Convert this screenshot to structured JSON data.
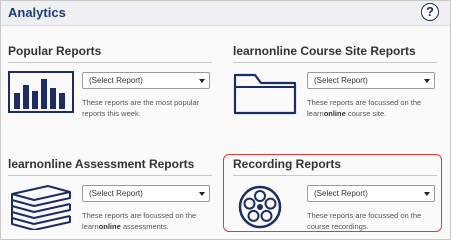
{
  "header": {
    "title": "Analytics",
    "help_label": "?"
  },
  "cards": [
    {
      "title": "Popular Reports",
      "select_value": "(Select Report)",
      "desc": "These reports are the most popular reports this week.",
      "icon": "bar-chart-icon"
    },
    {
      "title": "learnonline Course Site Reports",
      "select_value": "(Select Report)",
      "desc_pre": "These reports are focussed on the learn",
      "desc_bold": "online",
      "desc_post": " course site.",
      "icon": "folder-icon"
    },
    {
      "title": "learnonline Assessment Reports",
      "select_value": "(Select Report)",
      "desc_pre": "These reports are focussed on the learn",
      "desc_bold": "online",
      "desc_post": " assessments.",
      "icon": "books-icon"
    },
    {
      "title": "Recording Reports",
      "select_value": "(Select Report)",
      "desc": "These reports are focussed on the course recordings.",
      "icon": "film-reel-icon"
    }
  ],
  "colors": {
    "accent": "#1b2c66",
    "highlight": "#e53935",
    "title": "#1d3d7a"
  }
}
